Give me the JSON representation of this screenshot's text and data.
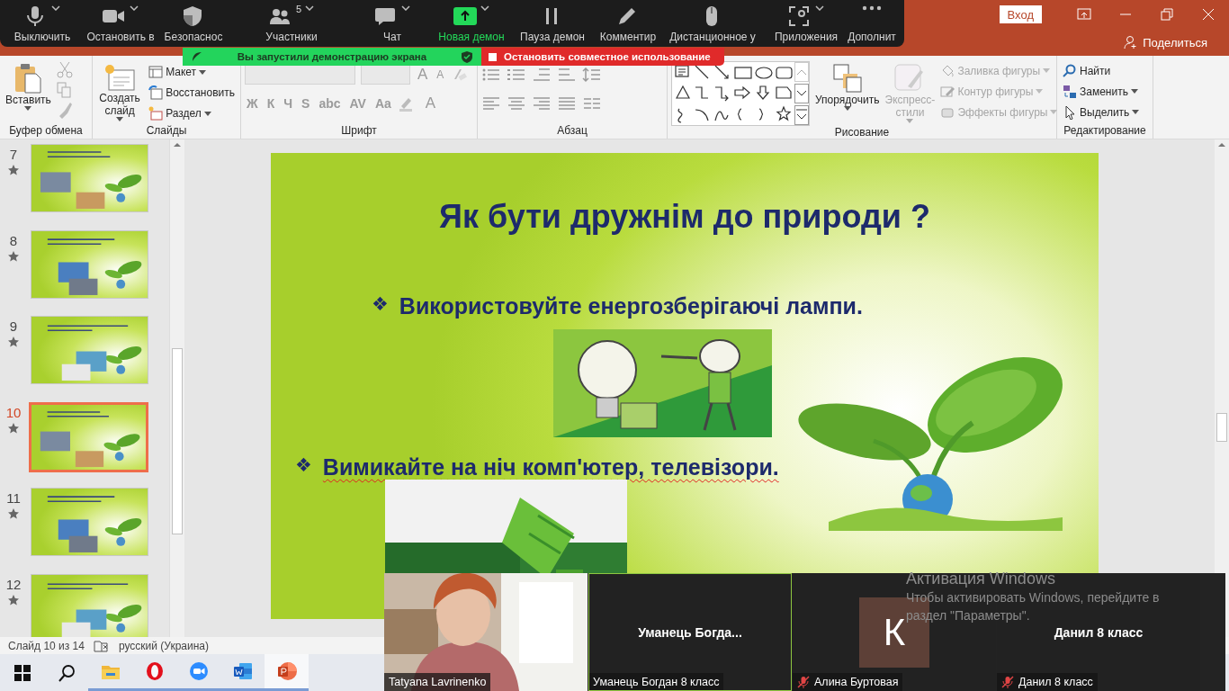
{
  "title_bar": {
    "sign_in": "Вход",
    "share": "Поделиться"
  },
  "zoom_toolbar": {
    "items": [
      {
        "kind": "mic",
        "label": "Выключить",
        "menu": true
      },
      {
        "kind": "camera",
        "label": "Остановить в",
        "menu": true
      },
      {
        "kind": "shield",
        "label": "Безопаснос",
        "menu": false
      },
      {
        "kind": "people",
        "label": "Участники",
        "menu": true,
        "badge": "5"
      },
      {
        "kind": "chat",
        "label": "Чат",
        "menu": true
      },
      {
        "kind": "share",
        "label": "Новая демон",
        "menu": true
      },
      {
        "kind": "pause",
        "label": "Пауза демон",
        "menu": false
      },
      {
        "kind": "pen",
        "label": "Комментир",
        "menu": false
      },
      {
        "kind": "mouse",
        "label": "Дистанционное у",
        "menu": false
      },
      {
        "kind": "apps",
        "label": "Приложения",
        "menu": true
      },
      {
        "kind": "more",
        "label": "Дополнит",
        "menu": false
      }
    ]
  },
  "share_banner": {
    "message": "Вы запустили демонстрацию экрана",
    "stop_button": "Остановить совместное использование"
  },
  "ribbon": {
    "clipboard": {
      "label": "Буфер обмена",
      "paste": "Вставить"
    },
    "slides": {
      "label": "Слайды",
      "new_slide": "Создать слайд",
      "commands": [
        {
          "label": "Макет",
          "menu": true
        },
        {
          "label": "Восстановить",
          "menu": false
        },
        {
          "label": "Раздел",
          "menu": true
        }
      ]
    },
    "font": {
      "label": "Шрифт",
      "size_buttons": [
        "A",
        "A"
      ],
      "format_buttons": [
        "Ж",
        "К",
        "Ч",
        "S",
        "abc",
        "AV",
        "Aa"
      ],
      "color_button": "A"
    },
    "paragraph": {
      "label": "Абзац"
    },
    "drawing": {
      "label": "Рисование",
      "arrange": "Упорядочить",
      "quick_styles": {
        "label": "Экспресс-стили",
        "disabled": true
      },
      "commands": [
        {
          "label": "Заливка фигуры",
          "disabled": true
        },
        {
          "label": "Контур фигуры",
          "disabled": true
        },
        {
          "label": "Эффекты фигуры",
          "disabled": true
        }
      ]
    },
    "editing": {
      "label": "Редактирование",
      "commands": [
        {
          "label": "Найти",
          "menu": false
        },
        {
          "label": "Заменить",
          "menu": true
        },
        {
          "label": "Выделить",
          "menu": true
        }
      ]
    }
  },
  "slides_panel": {
    "thumbnails": [
      {
        "number": "7",
        "selected": false
      },
      {
        "number": "8",
        "selected": false
      },
      {
        "number": "9",
        "selected": false
      },
      {
        "number": "10",
        "selected": true
      },
      {
        "number": "11",
        "selected": false
      },
      {
        "number": "12",
        "selected": false
      }
    ]
  },
  "slide": {
    "title": "Як бути дружнім до природи ?",
    "bullets": [
      {
        "marker": "❖",
        "text": "Використовуйте енергозберігаючі лампи.",
        "spelling_error": false
      },
      {
        "marker": "❖",
        "text": "Вимикайте на ніч комп'ютер, телевізори.",
        "spelling_error": true
      }
    ]
  },
  "status_bar": {
    "slide_counter": "Слайд 10 из 14",
    "language": "русский (Украина)"
  },
  "participants": {
    "tiles": [
      {
        "kind": "video",
        "caption": "Tatyana Lavrinenko",
        "muted": false,
        "speaking": false
      },
      {
        "kind": "name",
        "display_name": "Уманець  Богда...",
        "caption": "Уманець Богдан 8 класс",
        "muted": false,
        "speaking": true
      },
      {
        "kind": "avatar",
        "initial": "К",
        "caption": "Алина Буртовая",
        "muted": true,
        "speaking": false
      },
      {
        "kind": "name",
        "display_name": "Данил 8 класс",
        "caption": "Данил 8 класс",
        "muted": true,
        "speaking": false
      }
    ]
  },
  "activation_notice": {
    "title": "Активация Windows",
    "message": "Чтобы активировать Windows, перейдите в раздел \"Параметры\"."
  },
  "taskbar": {
    "items": [
      {
        "kind": "start",
        "running": false,
        "selected": false
      },
      {
        "kind": "search",
        "running": false,
        "selected": false
      },
      {
        "kind": "explorer",
        "running": true,
        "selected": false
      },
      {
        "kind": "opera",
        "running": true,
        "selected": false
      },
      {
        "kind": "zoom",
        "running": true,
        "selected": false
      },
      {
        "kind": "word",
        "running": true,
        "selected": false
      },
      {
        "kind": "powerpoint",
        "running": true,
        "selected": true
      }
    ]
  }
}
